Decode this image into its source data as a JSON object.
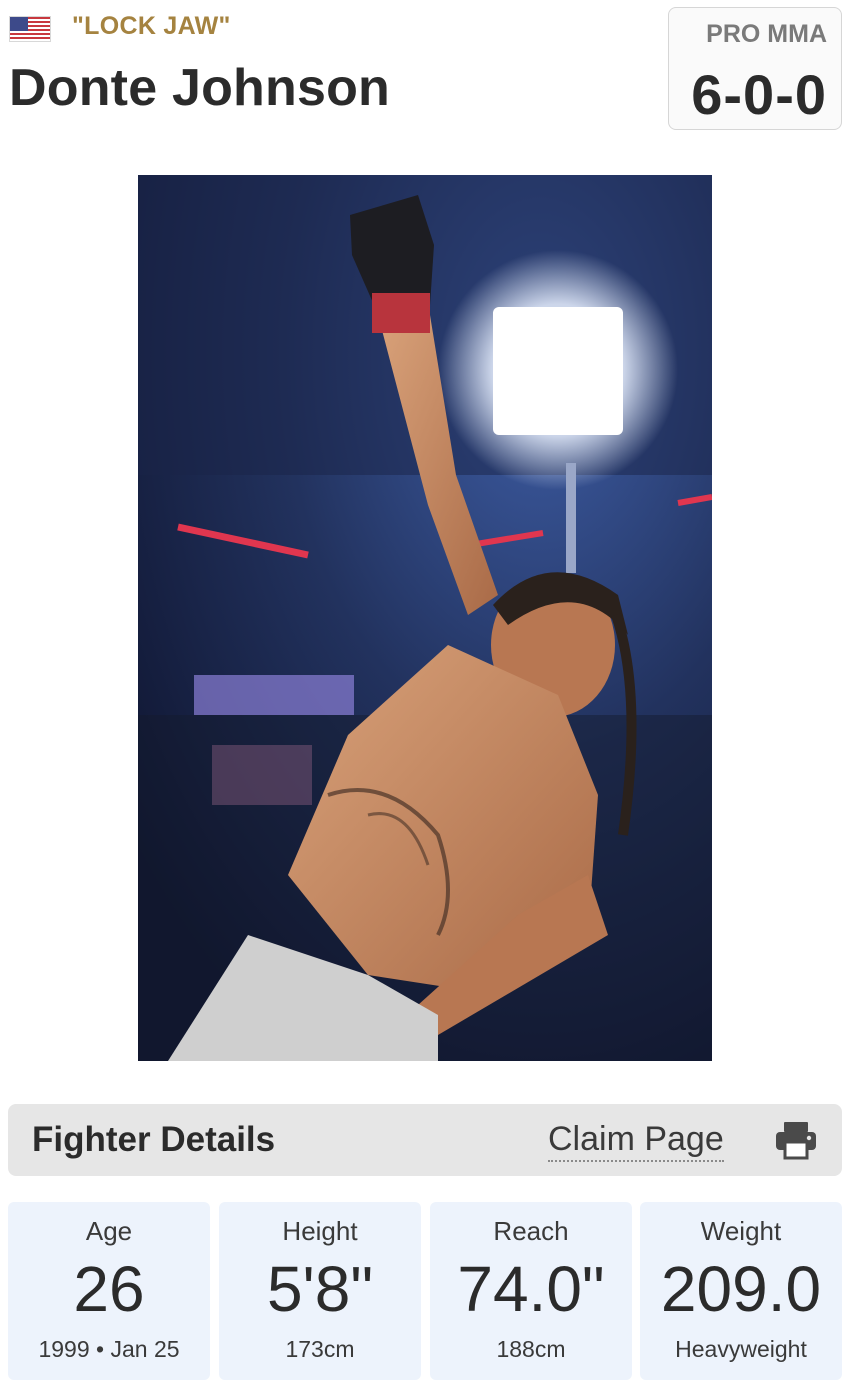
{
  "fighter": {
    "nickname": "\"LOCK JAW\"",
    "name": "Donte Johnson",
    "country_flag_icon": "us-flag-icon"
  },
  "record": {
    "label": "PRO MMA",
    "value": "6-0-0"
  },
  "details": {
    "title": "Fighter Details",
    "claim_label": "Claim Page",
    "print_icon": "printer-icon"
  },
  "stats": [
    {
      "label": "Age",
      "value": "26",
      "sub": "1999 • Jan 25"
    },
    {
      "label": "Height",
      "value": "5'8\"",
      "sub": "173cm"
    },
    {
      "label": "Reach",
      "value": "74.0\"",
      "sub": "188cm"
    },
    {
      "label": "Weight",
      "value": "209.0",
      "sub": "Heavyweight"
    }
  ],
  "colors": {
    "nickname": "#a58340",
    "stat_card_bg": "#edf3fc",
    "details_bar_bg": "#e6e6e6"
  }
}
